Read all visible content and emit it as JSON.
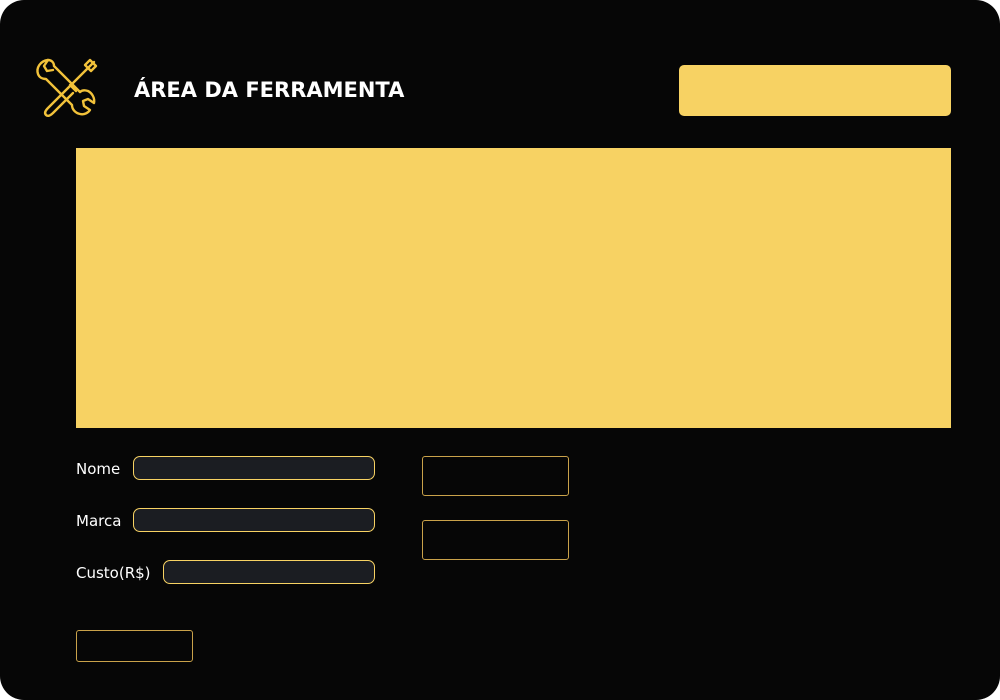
{
  "header": {
    "title": "ÁREA DA FERRAMENTA",
    "action_button_label": "",
    "logo_icon": "tools-icon"
  },
  "form": {
    "fields": [
      {
        "label": "Nome",
        "value": "",
        "placeholder": ""
      },
      {
        "label": "Marca",
        "value": "",
        "placeholder": ""
      },
      {
        "label": "Custo(R$)",
        "value": "",
        "placeholder": ""
      }
    ]
  },
  "buttons": {
    "side_top_label": "",
    "side_bottom_label": "",
    "bottom_label": ""
  },
  "colors": {
    "background": "#060606",
    "accent": "#f7d263",
    "input_background": "#1b1d22",
    "text": "#ffffff"
  }
}
